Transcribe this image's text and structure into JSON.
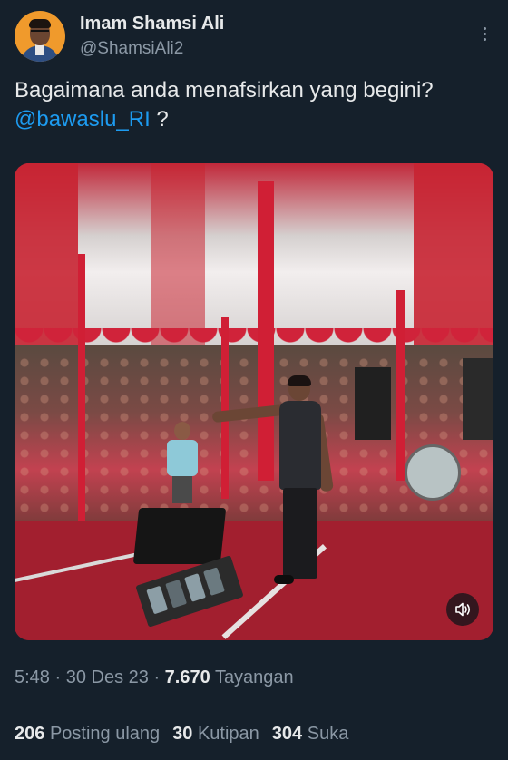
{
  "author": {
    "name": "Imam Shamsi Ali",
    "handle": "@ShamsiAli2"
  },
  "tweet": {
    "text_before": "Bagaimana anda menafsirkan yang begini? ",
    "mention": "@bawaslu_RI",
    "text_after": " ?"
  },
  "media": {
    "type": "video",
    "volume_icon": "speaker-volume-icon"
  },
  "meta": {
    "time": "5:48",
    "sep1": " · ",
    "date": "30 Des 23",
    "sep2": " · ",
    "views": "7.670",
    "views_label": "Tayangan"
  },
  "stats": {
    "reposts": "206",
    "reposts_label": "Posting ulang",
    "quotes": "30",
    "quotes_label": "Kutipan",
    "likes": "304",
    "likes_label": "Suka"
  },
  "colors": {
    "background": "#15202b",
    "text": "#e7e9ea",
    "secondary": "#8b98a5",
    "link": "#1d9bf0"
  }
}
